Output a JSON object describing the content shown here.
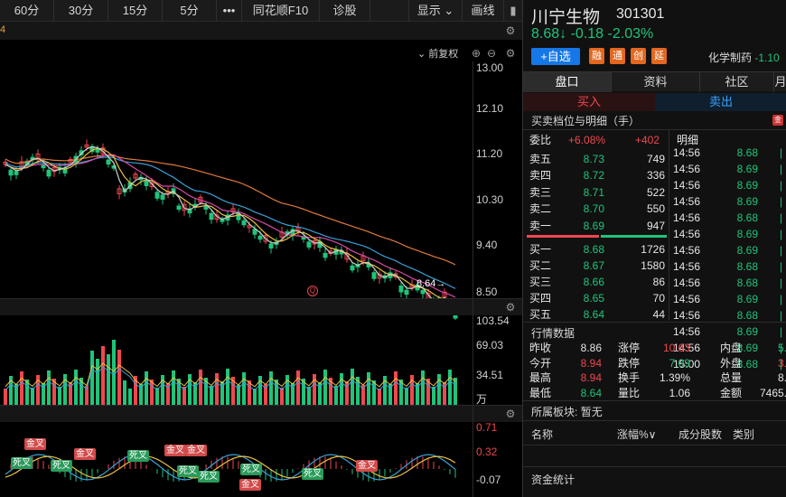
{
  "toolbar": {
    "items": [
      "60分",
      "30分",
      "15分",
      "5分",
      "•••",
      "同花顺F10",
      "诊股"
    ],
    "display_label": "显示",
    "draw_label": "画线"
  },
  "chart": {
    "adjust_label": "前复权",
    "price_axis": [
      "13.00",
      "12.10",
      "11.20",
      "10.30",
      "9.40",
      "8.50"
    ],
    "last_price_tag": "8.64→",
    "q_marker": "Q",
    "volume_axis": [
      "103.54",
      "69.03",
      "34.51",
      "万"
    ],
    "macd_axis": [
      "0.71",
      "0.32",
      "-0.07"
    ],
    "cross_labels": [
      {
        "text": "金叉",
        "type": "gold"
      },
      {
        "text": "死叉",
        "type": "dead"
      },
      {
        "text": "死叉",
        "type": "dead"
      },
      {
        "text": "金叉",
        "type": "gold"
      },
      {
        "text": "死叉",
        "type": "dead"
      },
      {
        "text": "金叉",
        "type": "gold"
      },
      {
        "text": "金叉",
        "type": "gold"
      },
      {
        "text": "死叉",
        "type": "dead"
      },
      {
        "text": "死叉",
        "type": "dead"
      },
      {
        "text": "死叉",
        "type": "dead"
      },
      {
        "text": "金叉",
        "type": "gold"
      },
      {
        "text": "死叉",
        "type": "dead"
      },
      {
        "text": "金叉",
        "type": "gold"
      }
    ]
  },
  "stock": {
    "name": "川宁生物",
    "code": "301301",
    "price": "8.68↓",
    "change": "-0.18",
    "change_pct": "-2.03%",
    "add_label": "+自选",
    "tags": [
      "融",
      "通",
      "创",
      "延"
    ],
    "industry": "化学制药",
    "industry_change": "-1.10"
  },
  "tabs": [
    "盘口",
    "资料",
    "社区",
    "月"
  ],
  "buy_label": "买入",
  "sell_label": "卖出",
  "depth_title": "买卖档位与明细（手）",
  "ratio": {
    "label": "委比",
    "pct": "+6.08%",
    "diff": "+402"
  },
  "detail_label": "明细",
  "asks": [
    {
      "label": "卖五",
      "price": "8.73",
      "vol": "749"
    },
    {
      "label": "卖四",
      "price": "8.72",
      "vol": "336"
    },
    {
      "label": "卖三",
      "price": "8.71",
      "vol": "522"
    },
    {
      "label": "卖二",
      "price": "8.70",
      "vol": "550"
    },
    {
      "label": "卖一",
      "price": "8.69",
      "vol": "947"
    }
  ],
  "bids": [
    {
      "label": "买一",
      "price": "8.68",
      "vol": "1726"
    },
    {
      "label": "买二",
      "price": "8.67",
      "vol": "1580"
    },
    {
      "label": "买三",
      "price": "8.66",
      "vol": "86"
    },
    {
      "label": "买四",
      "price": "8.65",
      "vol": "70"
    },
    {
      "label": "买五",
      "price": "8.64",
      "vol": "44"
    }
  ],
  "ticks": [
    {
      "time": "14:56",
      "price": "8.68",
      "c": "green"
    },
    {
      "time": "14:56",
      "price": "8.69",
      "c": "green"
    },
    {
      "time": "14:56",
      "price": "8.69",
      "c": "green"
    },
    {
      "time": "14:56",
      "price": "8.69",
      "c": "green"
    },
    {
      "time": "14:56",
      "price": "8.68",
      "c": "green"
    },
    {
      "time": "14:56",
      "price": "8.69",
      "c": "green"
    },
    {
      "time": "14:56",
      "price": "8.69",
      "c": "green"
    },
    {
      "time": "14:56",
      "price": "8.68",
      "c": "green"
    },
    {
      "time": "14:56",
      "price": "8.68",
      "c": "green"
    },
    {
      "time": "14:56",
      "price": "8.69",
      "c": "green"
    },
    {
      "time": "14:56",
      "price": "8.68",
      "c": "green"
    },
    {
      "time": "14:56",
      "price": "8.69",
      "c": "green"
    },
    {
      "time": "14:56",
      "price": "8.69",
      "c": "green"
    },
    {
      "time": "15:00",
      "price": "8.68",
      "c": "green"
    }
  ],
  "quote_title": "行情数据",
  "quote": [
    [
      {
        "k": "昨收",
        "v": "8.86",
        "c": "white"
      },
      {
        "k": "涨停",
        "v": "10.63",
        "c": "red"
      },
      {
        "k": "内盘",
        "v": "5.",
        "c": "green"
      }
    ],
    [
      {
        "k": "今开",
        "v": "8.94",
        "c": "red"
      },
      {
        "k": "跌停",
        "v": "7.09",
        "c": "green"
      },
      {
        "k": "外盘",
        "v": "3.",
        "c": "red"
      }
    ],
    [
      {
        "k": "最高",
        "v": "8.94",
        "c": "red"
      },
      {
        "k": "换手",
        "v": "1.39%",
        "c": "white"
      },
      {
        "k": "总量",
        "v": "8.",
        "c": "white"
      }
    ],
    [
      {
        "k": "最低",
        "v": "8.64",
        "c": "green"
      },
      {
        "k": "量比",
        "v": "1.06",
        "c": "white"
      },
      {
        "k": "金额",
        "v": "7465.",
        "c": "white"
      }
    ]
  ],
  "sector": {
    "label": "所属板块:",
    "value": "暂无"
  },
  "sector_headers": [
    "名称",
    "涨幅%∨",
    "成分股数",
    "类别"
  ],
  "fund_title": "资金统计"
}
